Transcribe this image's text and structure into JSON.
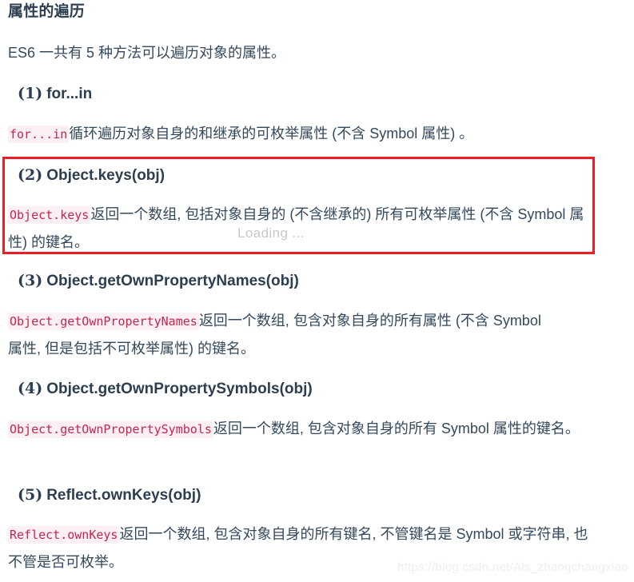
{
  "document": {
    "title": "属性的遍历",
    "intro": "ES6 一共有 5 种方法可以遍历对象的属性。"
  },
  "sections": [
    {
      "number": "(1)",
      "name": "for...in",
      "code": "for...in",
      "body_after_code": "循环遍历对象自身的和继承的可枚举属性 (不含 Symbol 属性) 。"
    },
    {
      "number": "(2)",
      "name": "Object.keys(obj)",
      "code": "Object.keys",
      "body_after_code": "返回一个数组, 包括对象自身的 (不含继承的) 所有可枚举属性 (不含 Symbol 属性) 的键名。"
    },
    {
      "number": "(3)",
      "name": "Object.getOwnPropertyNames(obj)",
      "code": "Object.getOwnPropertyNames",
      "body_after_code": "返回一个数组, 包含对象自身的所有属性 (不含 Symbol 属性, 但是包括不可枚举属性) 的键名。"
    },
    {
      "number": "(4)",
      "name": "Object.getOwnPropertySymbols(obj)",
      "code": "Object.getOwnPropertySymbols",
      "body_after_code": "返回一个数组, 包含对象自身的所有 Symbol 属性的键名。"
    },
    {
      "number": "(5)",
      "name": "Reflect.ownKeys(obj)",
      "code": "Reflect.ownKeys",
      "body_after_code": "返回一个数组, 包含对象自身的所有键名, 不管键名是 Symbol 或字符串, 也不管是否可枚举。"
    }
  ],
  "overlays": {
    "loading_text": "Loading ...",
    "watermark_text": "https://blog.csdn.net/Als_zhangchangxiao"
  },
  "colors": {
    "annotation_box": "#ee1c25",
    "inline_code_text": "#c7254e",
    "inline_code_bg": "#fdf0f4",
    "heading": "#2c3e50",
    "body_text": "#34495e",
    "loading_text": "#c9c9c9",
    "watermark": "#eeeeee",
    "page_background": "#ffffff"
  }
}
